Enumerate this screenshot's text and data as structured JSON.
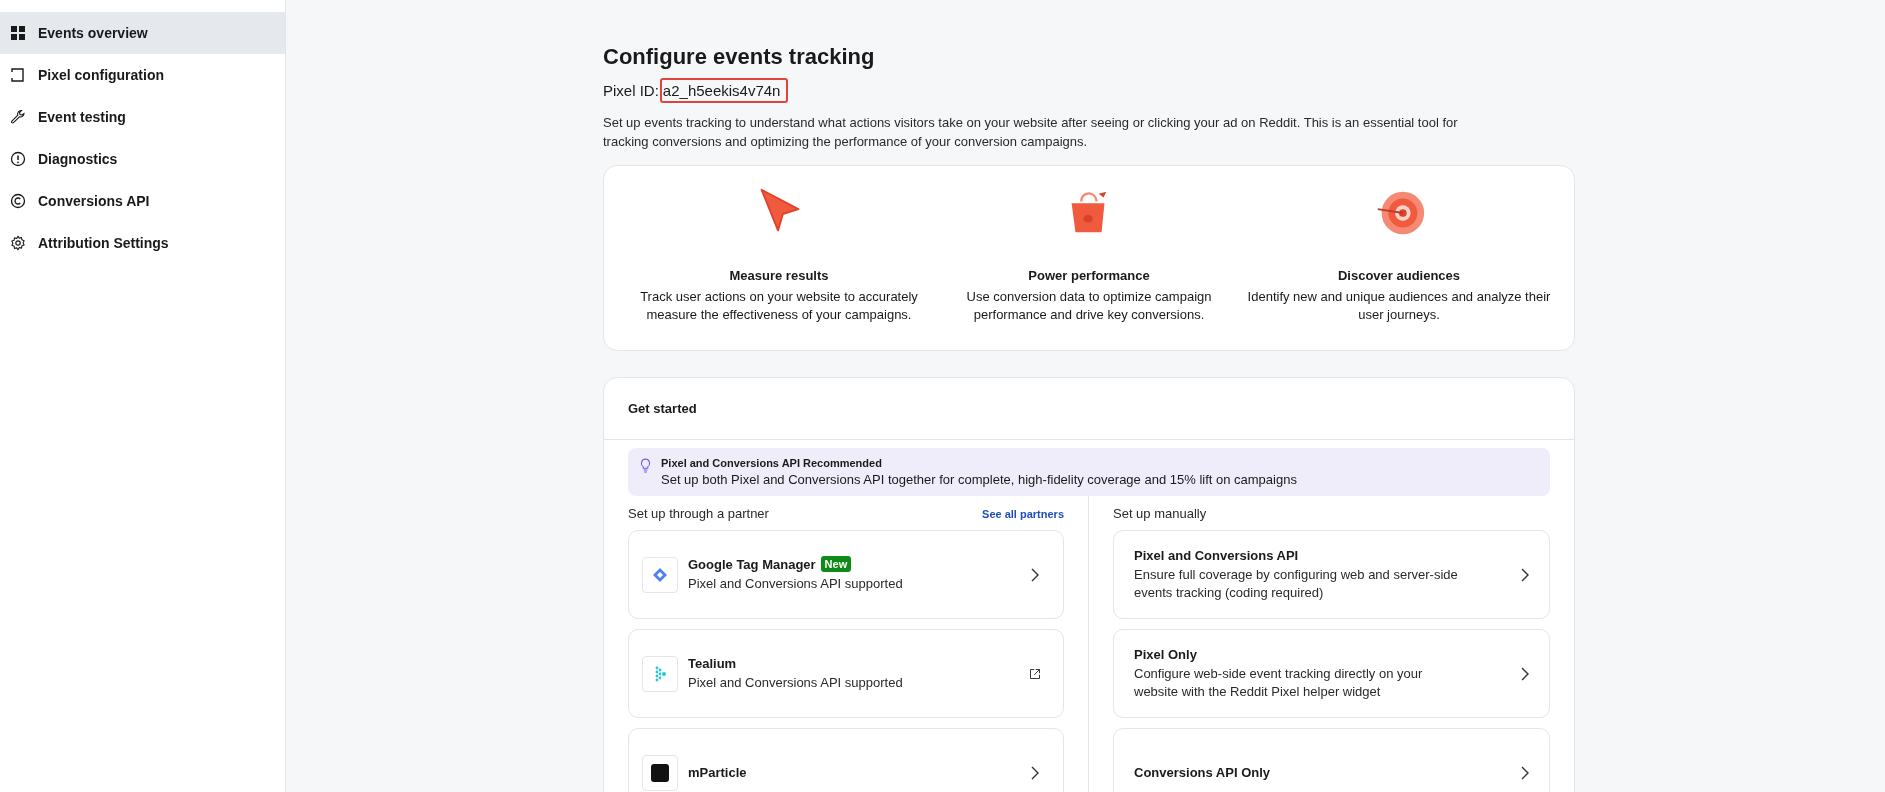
{
  "sidebar": {
    "items": [
      {
        "label": "Events overview",
        "selected": true
      },
      {
        "label": "Pixel configuration",
        "selected": false
      },
      {
        "label": "Event testing",
        "selected": false
      },
      {
        "label": "Diagnostics",
        "selected": false
      },
      {
        "label": "Conversions API",
        "selected": false
      },
      {
        "label": "Attribution Settings",
        "selected": false
      }
    ]
  },
  "header": {
    "title": "Configure events tracking",
    "pixel_id_label": "Pixel ID:",
    "pixel_id": "a2_h5eekis4v74n",
    "pixel_id_highlighted": true,
    "description": "Set up events tracking to understand what actions visitors take on your website after seeing or clicking your ad on Reddit. This is an essential tool for tracking conversions and optimizing the performance of your conversion campaigns."
  },
  "features": [
    {
      "title": "Measure results",
      "text": "Track user actions on your website to accurately measure the effectiveness of your campaigns."
    },
    {
      "title": "Power performance",
      "text": "Use conversion data to optimize campaign performance and drive key conversions."
    },
    {
      "title": "Discover audiences",
      "text": "Identify new and unique audiences and analyze their user journeys."
    }
  ],
  "get_started": {
    "title": "Get started",
    "banner": {
      "title": "Pixel and Conversions API Recommended",
      "text": "Set up both Pixel and Conversions API together for complete, high-fidelity coverage and 15% lift on campaigns"
    },
    "partner_column": {
      "label": "Set up through a partner",
      "link": "See all partners",
      "items": [
        {
          "name": "Google Tag Manager",
          "badge": "New",
          "subtitle": "Pixel and Conversions API supported",
          "kind": "chevron"
        },
        {
          "name": "Tealium",
          "subtitle": "Pixel and Conversions API supported",
          "kind": "external"
        },
        {
          "name": "mParticle",
          "kind": "chevron"
        }
      ]
    },
    "manual_column": {
      "label": "Set up manually",
      "items": [
        {
          "name": "Pixel and Conversions API",
          "text": "Ensure full coverage by configuring web and server-side events tracking (coding required)"
        },
        {
          "name": "Pixel Only",
          "text": "Configure web-side event tracking directly on your website with the Reddit Pixel helper widget"
        },
        {
          "name": "Conversions API Only"
        }
      ]
    }
  }
}
